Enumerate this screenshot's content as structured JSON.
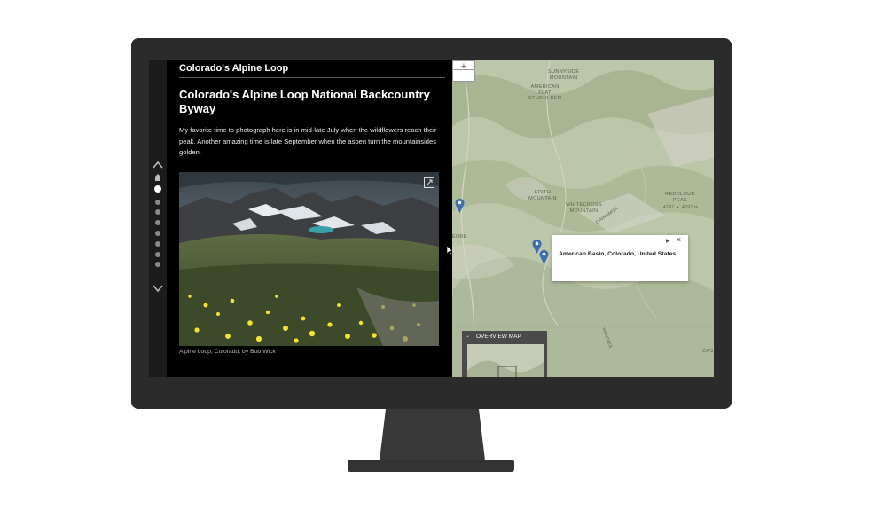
{
  "story": {
    "header_title": "Colorado's Alpine Loop",
    "title": "Colorado's Alpine Loop National Backcountry Byway",
    "body": "My favorite time to photograph here is in mid-late July when the wildflowers reach their peak. Another amazing time is late September when the aspen turn the mountainsides golden.",
    "caption": "Alpine Loop, Colorado, by Bob Wick"
  },
  "nav": {
    "up_icon": "chevron-up-icon",
    "down_icon": "chevron-down-icon",
    "home_icon": "home-icon",
    "dot_count": 9,
    "active_index": 0
  },
  "map": {
    "zoom_in": "+",
    "zoom_out": "−",
    "labels": {
      "sunnyside": "SUNNYSIDE\nMOUNTAIN",
      "american_flat": "AMERICAN\nFLAT\nSTUDIO BEN",
      "edith": "EDITH\nMOUNTAIN",
      "whitecross": "WHITECROSS\nMOUNTAIN",
      "redcloud": "REDCLOUD\nPEAK",
      "redcloud_elev": "4297 ▲ 4297 m",
      "cinnamon": "CINNAMON",
      "eure": "EURE",
      "handies": "HANDIES",
      "cas": "CAS"
    },
    "popup": {
      "text": "American Basin, Colorado, United States",
      "next_icon": "next-arrow-icon",
      "close_icon": "close-icon"
    },
    "overview_title": "OVERVIEW MAP"
  },
  "colors": {
    "bezel": "#2b2b2b",
    "pin": "#3d6fb0",
    "panel_bg": "#000000"
  }
}
